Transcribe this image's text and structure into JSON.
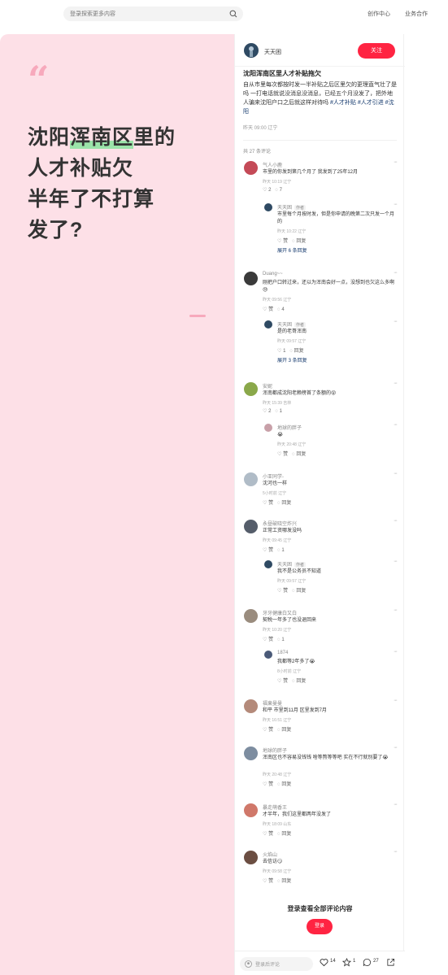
{
  "header": {
    "search_placeholder": "登录探索更多内容",
    "links": [
      "创作中心",
      "业务合作"
    ]
  },
  "hero": {
    "quote_mark": "“",
    "title_lines": [
      "沈阳",
      "浑南区",
      "里的",
      "人才补贴欠",
      "半年了不打算",
      "发了?"
    ]
  },
  "note": {
    "author": "天天困",
    "follow_label": "关注",
    "title": "沈阳浑南区里人才补贴拖欠",
    "body": "自从市里每次都按时发一半补贴之后区里欠的更理直气壮了是吗 一打电话就说没消息没消息，已经五个月没发了，把外地人骗来沈阳户口之后就这样对待吗",
    "tags": [
      "#人才补贴",
      "#人才引进",
      "#沈阳"
    ],
    "date": "昨天 09:00 辽宁",
    "comment_total": "共 27 条评论"
  },
  "comments": [
    {
      "name": "气人小鹿",
      "text": "市里的你发到第几个月了 我发到了25年12月",
      "meta": "昨天 10:19 辽宁",
      "likes": "2",
      "replies": "7"
    },
    {
      "name": "天天困",
      "author_tag": "作者",
      "text": "市里每个月按时发，但是你申请的晚第二次只发一个月的",
      "meta": "昨天 10:22 辽宁",
      "likes": "赞",
      "replies": "回复",
      "expand": "展开 6 条回复"
    },
    {
      "name": "Duang~~",
      "text": "刚把户口转过来，还以为浑南会好一点，没想到也欠这么多啊😓",
      "meta": "昨天 09:56 辽宁",
      "likes": "赞",
      "replies": "4"
    },
    {
      "name": "天天困",
      "author_tag": "作者",
      "text": "是的老哥浑南",
      "meta": "昨天 09:57 辽宁",
      "likes": "1",
      "replies": "回复",
      "expand": "展开 3 条回复"
    },
    {
      "name": "安妮",
      "text": "浑南都成沈阳老赖榜首了条额的😵",
      "meta": "昨天 15:39 吉林",
      "likes": "2",
      "replies": "1"
    },
    {
      "name": "地球的胖子",
      "text": "😭",
      "meta": "昨天 20:48 辽宁",
      "likes": "赞",
      "replies": "回复"
    },
    {
      "name": "小亚同学-",
      "text": "沈河也一样",
      "meta": "5小时前 辽宁",
      "likes": "赞",
      "replies": "回复"
    },
    {
      "name": "永昼破晓空炸兴",
      "text": "正常工资哪发没吗",
      "meta": "昨天 09:45 辽宁",
      "likes": "赞",
      "replies": "1"
    },
    {
      "name": "天天困",
      "author_tag": "作者",
      "text": "我不是公务员不知道",
      "meta": "昨天 09:57 辽宁",
      "likes": "赞",
      "replies": "回复"
    },
    {
      "name": "牙牙健康白又白",
      "text": "契税一年多了也没退回来",
      "meta": "昨天 10:20 辽宁",
      "likes": "赞",
      "replies": "1"
    },
    {
      "name": "1874",
      "text": "我都等2年多了😭",
      "meta": "8小时前 辽宁",
      "likes": "赞",
      "replies": "回复"
    },
    {
      "name": "福東曼曼",
      "text": "和平 市里到11月 区里发到7月",
      "meta": "昨天 16:51 辽宁",
      "likes": "赞",
      "replies": "回复"
    },
    {
      "name": "地球的胖子",
      "text": "浑南区也不容易没钱钱 啥等熬等等吧 实在不行就别要了😭",
      "meta": "昨天 20:48 辽宁",
      "likes": "赞",
      "replies": "回复"
    },
    {
      "name": "暴走萌香王",
      "text": "才半年，我们这里都两年没发了",
      "meta": "昨天 18:09 山东",
      "likes": "赞",
      "replies": "回复"
    },
    {
      "name": "火焰山",
      "text": "去信访😏",
      "meta": "昨天 09:58 辽宁",
      "likes": "赞",
      "replies": "回复"
    }
  ],
  "login_prompt": {
    "title": "登录查看全部评论内容",
    "button": "登录"
  },
  "bottom_bar": {
    "placeholder": "登录后评论",
    "likes": "14",
    "collects": "1",
    "comments": "27"
  },
  "colors": {
    "accent": "#ff2442",
    "hero_bg": "#fde0e7",
    "highlight": "#9be3a9",
    "tag": "#13386c"
  }
}
